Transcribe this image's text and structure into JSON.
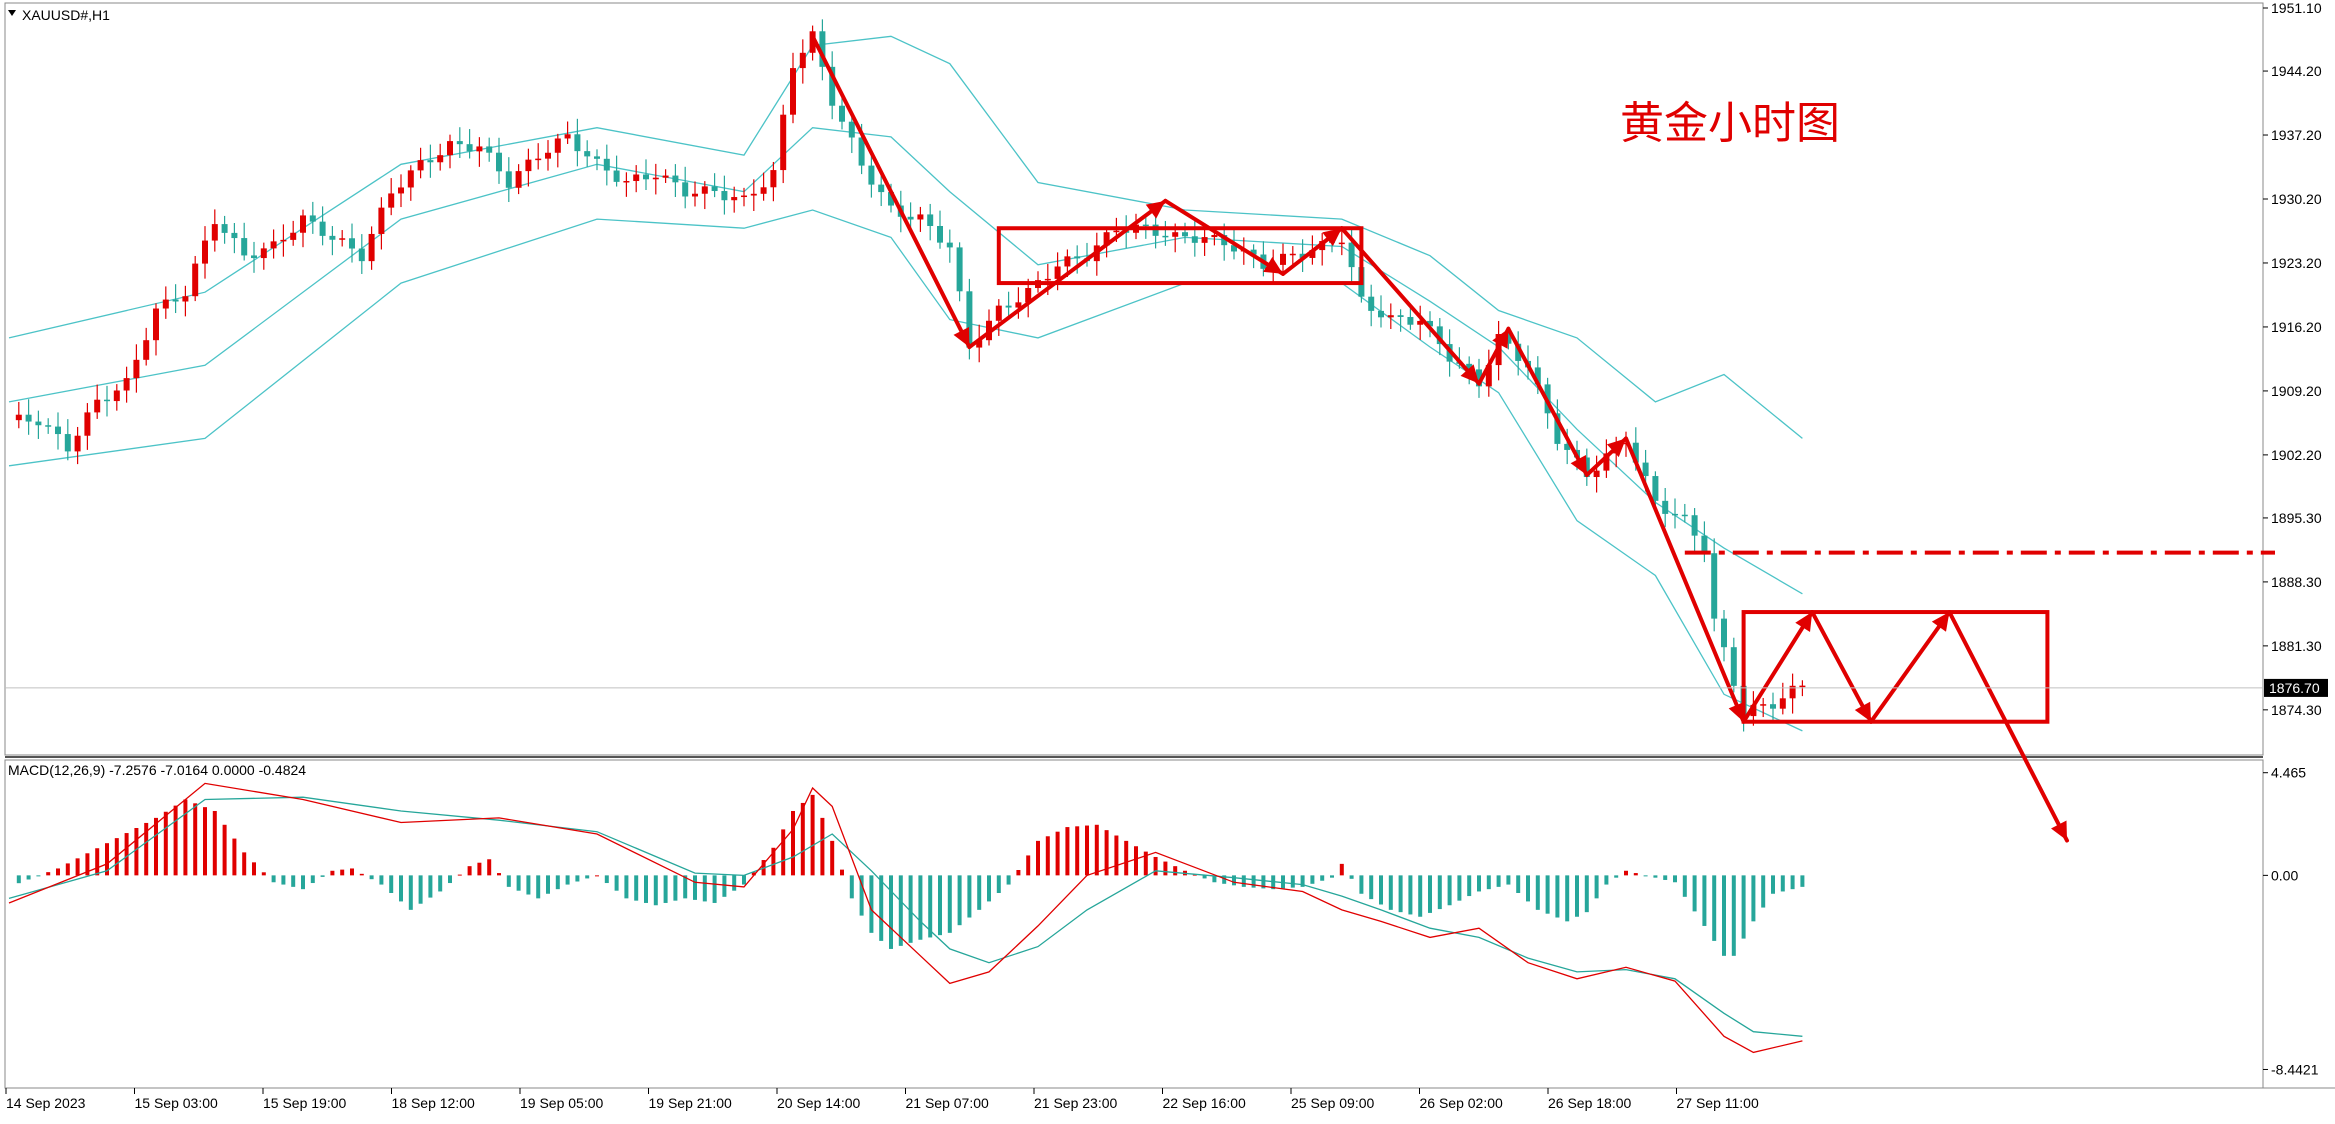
{
  "chart_data": [
    {
      "type": "candlestick",
      "panel": "main",
      "symbol_label": "XAUUSD#,H1",
      "annotation_title": "黄金小时图",
      "indicator": "Bollinger Bands",
      "ylim": [
        1871.0,
        1951.1
      ],
      "y_ticks": [
        "1951.10",
        "1944.20",
        "1937.20",
        "1930.20",
        "1923.20",
        "1916.20",
        "1909.20",
        "1902.20",
        "1895.30",
        "1888.30",
        "1881.30",
        "1874.30"
      ],
      "current_price": 1876.7,
      "current_price_label": "1876.70",
      "x_tick_labels": [
        "14 Sep 2023",
        "15 Sep 03:00",
        "15 Sep 19:00",
        "18 Sep 12:00",
        "19 Sep 05:00",
        "19 Sep 21:00",
        "20 Sep 14:00",
        "21 Sep 07:00",
        "21 Sep 23:00",
        "22 Sep 16:00",
        "25 Sep 09:00",
        "26 Sep 02:00",
        "26 Sep 18:00",
        "27 Sep 11:00"
      ],
      "price_path": [
        [
          0,
          1906
        ],
        [
          3,
          1906
        ],
        [
          6,
          1903
        ],
        [
          9,
          1908
        ],
        [
          12,
          1910
        ],
        [
          15,
          1918
        ],
        [
          18,
          1920
        ],
        [
          21,
          1928
        ],
        [
          24,
          1924
        ],
        [
          27,
          1925
        ],
        [
          30,
          1928
        ],
        [
          33,
          1926
        ],
        [
          36,
          1924
        ],
        [
          39,
          1931
        ],
        [
          42,
          1934
        ],
        [
          45,
          1936
        ],
        [
          48,
          1936
        ],
        [
          51,
          1932
        ],
        [
          54,
          1935
        ],
        [
          57,
          1937
        ],
        [
          60,
          1934
        ],
        [
          63,
          1932
        ],
        [
          66,
          1933
        ],
        [
          69,
          1931
        ],
        [
          72,
          1931
        ],
        [
          75,
          1930
        ],
        [
          78,
          1933
        ],
        [
          80,
          1945
        ],
        [
          82,
          1948
        ],
        [
          84,
          1941
        ],
        [
          87,
          1934
        ],
        [
          90,
          1929
        ],
        [
          93,
          1928
        ],
        [
          96,
          1925
        ],
        [
          98,
          1914
        ],
        [
          101,
          1918
        ],
        [
          104,
          1920
        ],
        [
          107,
          1923
        ],
        [
          110,
          1924
        ],
        [
          113,
          1927
        ],
        [
          116,
          1927
        ],
        [
          119,
          1926
        ],
        [
          122,
          1926
        ],
        [
          125,
          1925
        ],
        [
          128,
          1923
        ],
        [
          131,
          1924
        ],
        [
          134,
          1925
        ],
        [
          136,
          1926
        ],
        [
          138,
          1919
        ],
        [
          141,
          1917
        ],
        [
          144,
          1917
        ],
        [
          147,
          1913
        ],
        [
          150,
          1910
        ],
        [
          152,
          1915
        ],
        [
          155,
          1912
        ],
        [
          158,
          1904
        ],
        [
          161,
          1900
        ],
        [
          163,
          1902
        ],
        [
          165,
          1904
        ],
        [
          168,
          1897
        ],
        [
          171,
          1895
        ],
        [
          173,
          1892
        ],
        [
          174,
          1884
        ],
        [
          177,
          1874
        ],
        [
          180,
          1875
        ],
        [
          183,
          1877
        ]
      ],
      "bollinger": {
        "upper": [
          [
            0,
            1915
          ],
          [
            20,
            1920
          ],
          [
            40,
            1934
          ],
          [
            60,
            1938
          ],
          [
            75,
            1935
          ],
          [
            82,
            1947
          ],
          [
            90,
            1948
          ],
          [
            96,
            1945
          ],
          [
            105,
            1932
          ],
          [
            120,
            1929
          ],
          [
            136,
            1928
          ],
          [
            145,
            1924
          ],
          [
            152,
            1918
          ],
          [
            160,
            1915
          ],
          [
            168,
            1908
          ],
          [
            175,
            1911
          ],
          [
            183,
            1904
          ]
        ],
        "middle": [
          [
            0,
            1908
          ],
          [
            20,
            1912
          ],
          [
            40,
            1928
          ],
          [
            60,
            1934
          ],
          [
            75,
            1931
          ],
          [
            82,
            1938
          ],
          [
            90,
            1937
          ],
          [
            96,
            1931
          ],
          [
            105,
            1923
          ],
          [
            120,
            1926
          ],
          [
            136,
            1925
          ],
          [
            145,
            1919
          ],
          [
            152,
            1914
          ],
          [
            160,
            1905
          ],
          [
            168,
            1897
          ],
          [
            175,
            1892
          ],
          [
            183,
            1887
          ]
        ],
        "lower": [
          [
            0,
            1901
          ],
          [
            20,
            1904
          ],
          [
            40,
            1921
          ],
          [
            60,
            1928
          ],
          [
            75,
            1927
          ],
          [
            82,
            1929
          ],
          [
            90,
            1926
          ],
          [
            96,
            1917
          ],
          [
            105,
            1915
          ],
          [
            120,
            1921
          ],
          [
            136,
            1921
          ],
          [
            145,
            1914
          ],
          [
            152,
            1909
          ],
          [
            160,
            1895
          ],
          [
            168,
            1889
          ],
          [
            175,
            1876
          ],
          [
            183,
            1872
          ]
        ]
      },
      "annotations": {
        "arrows": [
          [
            [
              82,
              1948
            ],
            [
              98,
              1914
            ]
          ],
          [
            [
              98,
              1914
            ],
            [
              118,
              1930
            ]
          ],
          [
            [
              118,
              1930
            ],
            [
              130,
              1922
            ]
          ],
          [
            [
              130,
              1922
            ],
            [
              136,
              1927
            ]
          ],
          [
            [
              136,
              1927
            ],
            [
              150,
              1910
            ]
          ],
          [
            [
              150,
              1910
            ],
            [
              153,
              1916
            ]
          ],
          [
            [
              153,
              1916
            ],
            [
              161,
              1900
            ]
          ],
          [
            [
              161,
              1900
            ],
            [
              165,
              1904
            ]
          ],
          [
            [
              165,
              1904
            ],
            [
              177,
              1873
            ]
          ],
          [
            [
              177,
              1873
            ],
            [
              184,
              1885
            ]
          ],
          [
            [
              184,
              1885
            ],
            [
              190,
              1873
            ]
          ],
          [
            [
              190,
              1873
            ],
            [
              198,
              1885
            ]
          ],
          [
            [
              198,
              1885
            ],
            [
              210,
              1860
            ]
          ]
        ],
        "boxes": [
          [
            [
              101,
              1927
            ],
            [
              138,
              1921
            ]
          ],
          [
            [
              177,
              1885
            ],
            [
              208,
              1873
            ]
          ]
        ],
        "resistance_level": 1891.5
      }
    },
    {
      "type": "macd",
      "panel": "sub",
      "label": "MACD(12,26,9) -7.2576 -7.0164 0.0000 -0.4824",
      "ylim": [
        -8.9,
        4.8
      ],
      "y_ticks": [
        "4.465",
        "0.00",
        "-8.4421"
      ],
      "histogram": [
        [
          0,
          -0.5
        ],
        [
          5,
          0.3
        ],
        [
          10,
          1.4
        ],
        [
          15,
          2.5
        ],
        [
          18,
          3.3
        ],
        [
          21,
          2.8
        ],
        [
          24,
          1.0
        ],
        [
          27,
          -0.3
        ],
        [
          30,
          -0.6
        ],
        [
          33,
          0.2
        ],
        [
          35,
          0.3
        ],
        [
          38,
          -0.4
        ],
        [
          41,
          -1.5
        ],
        [
          44,
          -0.7
        ],
        [
          47,
          0.4
        ],
        [
          49,
          0.7
        ],
        [
          51,
          -0.5
        ],
        [
          54,
          -1.0
        ],
        [
          57,
          -0.4
        ],
        [
          60,
          0.0
        ],
        [
          63,
          -1.0
        ],
        [
          66,
          -1.3
        ],
        [
          69,
          -1.0
        ],
        [
          72,
          -1.2
        ],
        [
          75,
          -0.4
        ],
        [
          78,
          1.2
        ],
        [
          80,
          2.8
        ],
        [
          82,
          3.5
        ],
        [
          84,
          1.5
        ],
        [
          86,
          -1.0
        ],
        [
          88,
          -2.5
        ],
        [
          90,
          -3.2
        ],
        [
          93,
          -2.8
        ],
        [
          96,
          -2.5
        ],
        [
          99,
          -1.5
        ],
        [
          102,
          -0.4
        ],
        [
          105,
          1.5
        ],
        [
          108,
          2.1
        ],
        [
          111,
          2.2
        ],
        [
          114,
          1.5
        ],
        [
          117,
          0.8
        ],
        [
          120,
          0.2
        ],
        [
          123,
          -0.3
        ],
        [
          126,
          -0.5
        ],
        [
          129,
          -0.6
        ],
        [
          132,
          -0.5
        ],
        [
          135,
          -0.1
        ],
        [
          136,
          0.5
        ],
        [
          138,
          -0.8
        ],
        [
          141,
          -1.5
        ],
        [
          144,
          -1.8
        ],
        [
          147,
          -1.3
        ],
        [
          150,
          -0.7
        ],
        [
          153,
          -0.4
        ],
        [
          156,
          -1.5
        ],
        [
          159,
          -2.0
        ],
        [
          161,
          -1.6
        ],
        [
          163,
          -0.4
        ],
        [
          165,
          0.2
        ],
        [
          168,
          -0.1
        ],
        [
          170,
          -0.3
        ],
        [
          173,
          -2.2
        ],
        [
          175,
          -3.5
        ],
        [
          176,
          -3.5
        ],
        [
          178,
          -2.0
        ],
        [
          180,
          -0.8
        ],
        [
          183,
          -0.5
        ]
      ],
      "main_line": [
        [
          0,
          -1.2
        ],
        [
          10,
          0.5
        ],
        [
          20,
          4.0
        ],
        [
          30,
          3.3
        ],
        [
          40,
          2.3
        ],
        [
          50,
          2.5
        ],
        [
          60,
          1.8
        ],
        [
          70,
          -0.3
        ],
        [
          75,
          -0.5
        ],
        [
          80,
          2.0
        ],
        [
          82,
          3.8
        ],
        [
          84,
          3.0
        ],
        [
          88,
          -1.5
        ],
        [
          93,
          -3.5
        ],
        [
          96,
          -4.7
        ],
        [
          100,
          -4.2
        ],
        [
          105,
          -2.2
        ],
        [
          110,
          0.0
        ],
        [
          117,
          1.0
        ],
        [
          125,
          -0.3
        ],
        [
          132,
          -0.7
        ],
        [
          136,
          -1.5
        ],
        [
          140,
          -2.0
        ],
        [
          145,
          -2.7
        ],
        [
          150,
          -2.3
        ],
        [
          155,
          -3.8
        ],
        [
          160,
          -4.5
        ],
        [
          165,
          -4.0
        ],
        [
          170,
          -4.6
        ],
        [
          175,
          -7.0
        ],
        [
          178,
          -7.7
        ],
        [
          183,
          -7.2
        ]
      ],
      "signal_line": [
        [
          0,
          -1.0
        ],
        [
          10,
          0.2
        ],
        [
          20,
          3.3
        ],
        [
          30,
          3.4
        ],
        [
          40,
          2.8
        ],
        [
          50,
          2.4
        ],
        [
          60,
          1.9
        ],
        [
          70,
          0.1
        ],
        [
          75,
          0.0
        ],
        [
          80,
          0.8
        ],
        [
          84,
          1.8
        ],
        [
          88,
          0.2
        ],
        [
          93,
          -2.0
        ],
        [
          96,
          -3.2
        ],
        [
          100,
          -3.8
        ],
        [
          105,
          -3.1
        ],
        [
          110,
          -1.5
        ],
        [
          117,
          0.2
        ],
        [
          125,
          -0.1
        ],
        [
          132,
          -0.4
        ],
        [
          136,
          -0.9
        ],
        [
          140,
          -1.5
        ],
        [
          145,
          -2.3
        ],
        [
          150,
          -2.7
        ],
        [
          155,
          -3.6
        ],
        [
          160,
          -4.2
        ],
        [
          165,
          -4.1
        ],
        [
          170,
          -4.5
        ],
        [
          175,
          -6.0
        ],
        [
          178,
          -6.8
        ],
        [
          183,
          -7.0
        ]
      ]
    }
  ]
}
